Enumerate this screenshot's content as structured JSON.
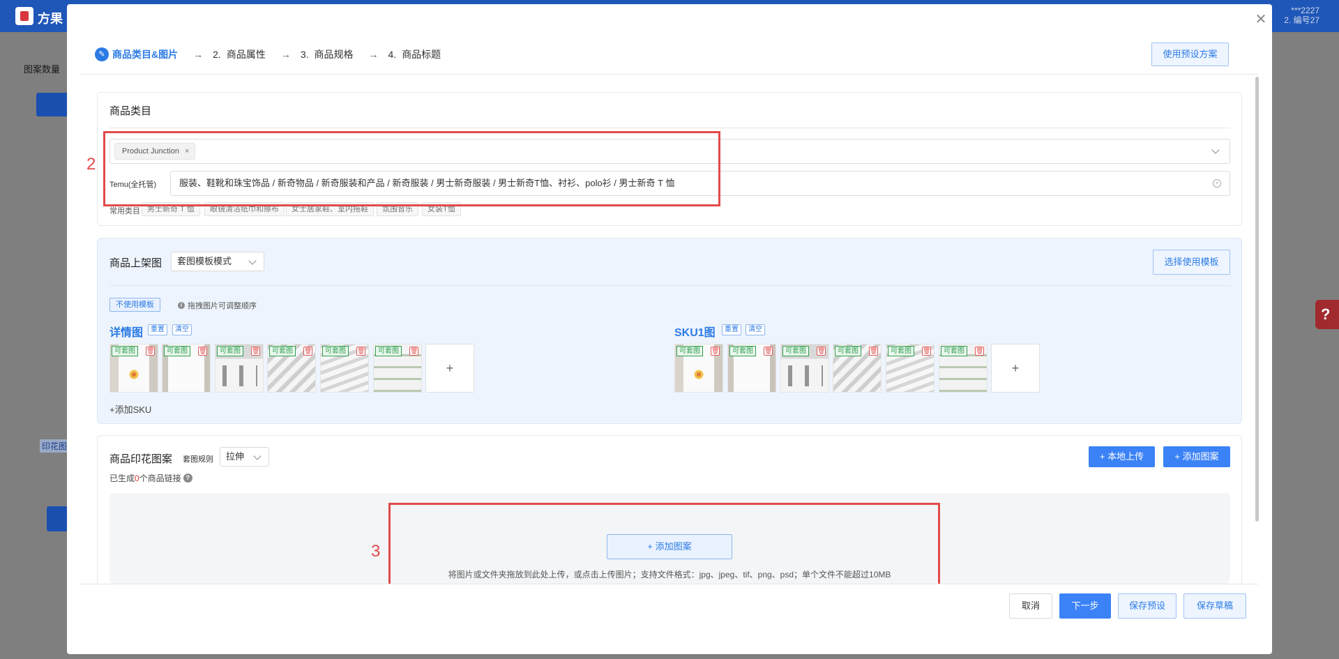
{
  "background": {
    "brand": "方果",
    "user_line1": "***2227",
    "user_line2": "2. 编号27",
    "pattern_count_label": "图案数量",
    "print_tag": "印花图"
  },
  "steps": [
    {
      "label": "商品类目&图片",
      "active": true
    },
    {
      "num": "2.",
      "label": "商品属性"
    },
    {
      "num": "3.",
      "label": "商品规格"
    },
    {
      "num": "4.",
      "label": "商品标题"
    }
  ],
  "preset_button": "使用预设方案",
  "category": {
    "title": "商品类目",
    "chip": "Product Junction",
    "temu_label": "Temu(全托管)",
    "temu_path": "服装、鞋靴和珠宝饰品 / 新奇物品 / 新奇服装和产品 / 新奇服装 / 男士新奇服装 / 男士新奇T恤、衬衫、polo衫 / 男士新奇 T 恤",
    "common_label": "常用类目",
    "common_tags": [
      "男士新奇 T 恤",
      "眼镜清洁纸巾和擦布",
      "女士居家鞋、室内拖鞋",
      "氛围音乐",
      "女装T恤"
    ]
  },
  "listing": {
    "title": "商品上架图",
    "mode": "套图模板模式",
    "template_button": "选择使用模板",
    "no_template_tag": "不使用模板",
    "drag_hint": "拖拽图片可调整顺序",
    "detail_title": "详情图",
    "sku_title": "SKU1图",
    "reset": "重置",
    "clear": "清空",
    "badge": "可套图",
    "add_sku": "+添加SKU"
  },
  "pattern": {
    "title": "商品印花图案",
    "rule_label": "套图规则",
    "rule_value": "拉伸",
    "local_upload": "+ 本地上传",
    "add_pattern": "+ 添加图案",
    "generated_prefix": "已生成",
    "generated_count": "0",
    "generated_suffix": "个商品链接",
    "drop_button": "+ 添加图案",
    "drop_hint": "将图片或文件夹拖放到此处上传，或点击上传图片；支持文件格式：jpg、jpeg、tif、png、psd；单个文件不能超过10MB"
  },
  "annotations": {
    "box2": "2",
    "box3": "3"
  },
  "footer": {
    "cancel": "取消",
    "next": "下一步",
    "save_preset": "保存预设",
    "save_draft": "保存草稿"
  },
  "icons": {
    "close": "close-icon",
    "help": "question-icon"
  }
}
